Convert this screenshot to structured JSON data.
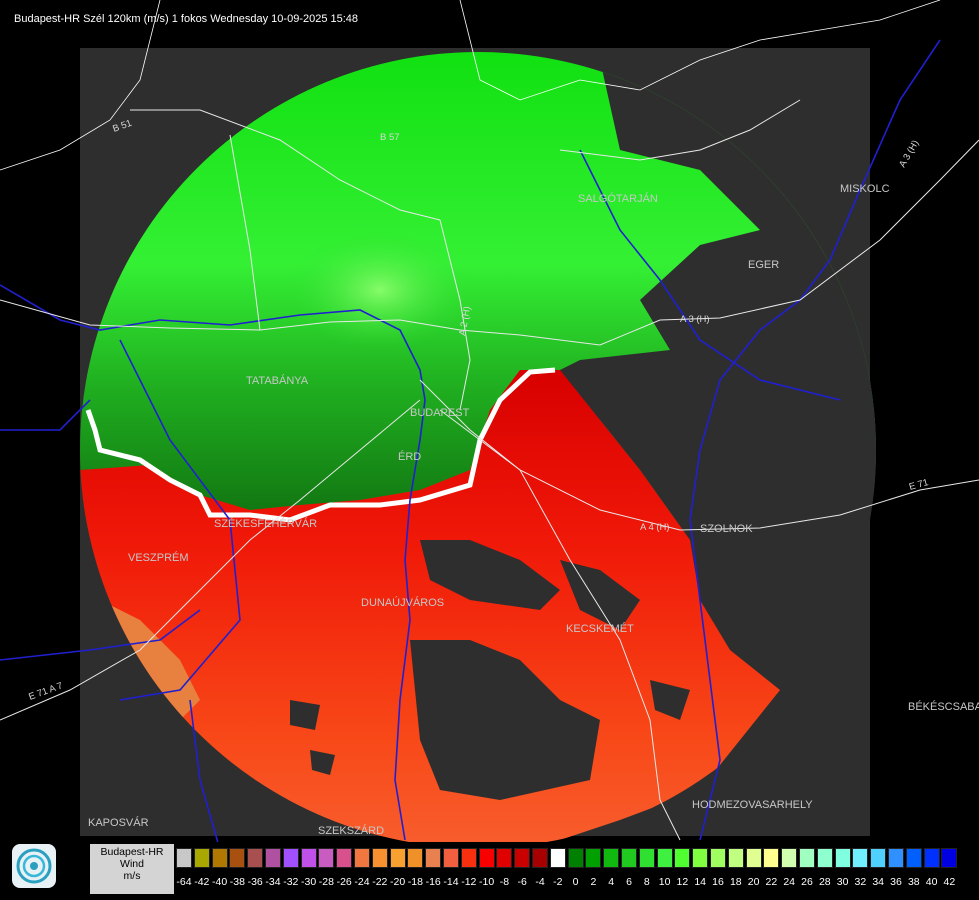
{
  "title": "Budapest-HR Szél 120km (m/s) 1 fokos Wednesday 10-09-2025 15:48",
  "map": {
    "cities": [
      {
        "id": "salgotarjan",
        "name": "SALGÓTARJÁN"
      },
      {
        "id": "miskolc",
        "name": "MISKOLC"
      },
      {
        "id": "eger",
        "name": "EGER"
      },
      {
        "id": "tatabanya",
        "name": "TATABÁNYA"
      },
      {
        "id": "budapest",
        "name": "BUDAPEST"
      },
      {
        "id": "erd",
        "name": "ÉRD"
      },
      {
        "id": "szekesfehervar",
        "name": "SZÉKESFEHÉRVÁR"
      },
      {
        "id": "veszprem",
        "name": "VESZPRÉM"
      },
      {
        "id": "szolnok",
        "name": "SZOLNOK"
      },
      {
        "id": "dunaujvaros",
        "name": "DUNAÚJVÁROS"
      },
      {
        "id": "kecskemet",
        "name": "KECSKEMÉT"
      },
      {
        "id": "bekescsaba",
        "name": "BÉKÉSCSABA"
      },
      {
        "id": "hodmezovasarhely",
        "name": "HODMEZOVASARHELY"
      },
      {
        "id": "kaposvar",
        "name": "KAPOSVÁR"
      },
      {
        "id": "szekszard",
        "name": "SZEKSZÁRD"
      }
    ],
    "roads": [
      {
        "id": "b51",
        "name": "B 51"
      },
      {
        "id": "b57",
        "name": "B 57"
      },
      {
        "id": "a3h",
        "name": "A 3 (H)"
      },
      {
        "id": "a3h_ne",
        "name": "A 3 (H)"
      },
      {
        "id": "e71",
        "name": "E 71"
      },
      {
        "id": "a4h",
        "name": "A 4 (H)"
      },
      {
        "id": "e71a7",
        "name": "E 71 A 7"
      },
      {
        "id": "a2",
        "name": "A 2 (H)"
      }
    ]
  },
  "legend": {
    "label_lines": [
      "Budapest-HR",
      "Wind",
      "m/s"
    ],
    "ticks": [
      "-64",
      "-42",
      "-40",
      "-38",
      "-36",
      "-34",
      "-32",
      "-30",
      "-28",
      "-26",
      "-24",
      "-22",
      "-20",
      "-18",
      "-16",
      "-14",
      "-12",
      "-10",
      "-8",
      "-6",
      "-4",
      "-2",
      "0",
      "2",
      "4",
      "6",
      "8",
      "10",
      "12",
      "14",
      "16",
      "18",
      "20",
      "22",
      "24",
      "26",
      "28",
      "30",
      "32",
      "34",
      "36",
      "38",
      "40",
      "42"
    ],
    "colors": [
      "#c8c8c8",
      "#a8a800",
      "#b07800",
      "#a85010",
      "#a85050",
      "#b050a0",
      "#a050ff",
      "#c050e8",
      "#c85cc0",
      "#d8508c",
      "#f07840",
      "#f89030",
      "#f8a030",
      "#f09028",
      "#e88050",
      "#f06040",
      "#f83010",
      "#f80000",
      "#e00000",
      "#c80000",
      "#a80000",
      "#ffffff",
      "#008000",
      "#00a000",
      "#10b810",
      "#20c820",
      "#30e030",
      "#40f040",
      "#50ff30",
      "#80ff40",
      "#a0ff60",
      "#c0ff80",
      "#e0ff90",
      "#ffff90",
      "#d0ffb0",
      "#a0ffc0",
      "#90ffd0",
      "#80ffe0",
      "#70f0ff",
      "#50d0ff",
      "#3090ff",
      "#0060ff",
      "#0030ff",
      "#0000e0"
    ]
  },
  "logo": {
    "icon": "radar-service-logo-icon"
  },
  "colors": {
    "background": "#000000",
    "radar_area": "#2e2e2e",
    "inbound_green": "#30d830",
    "outbound_red": "#f82010",
    "rivers": "#2020d0",
    "roads": "#e8e8e8"
  }
}
